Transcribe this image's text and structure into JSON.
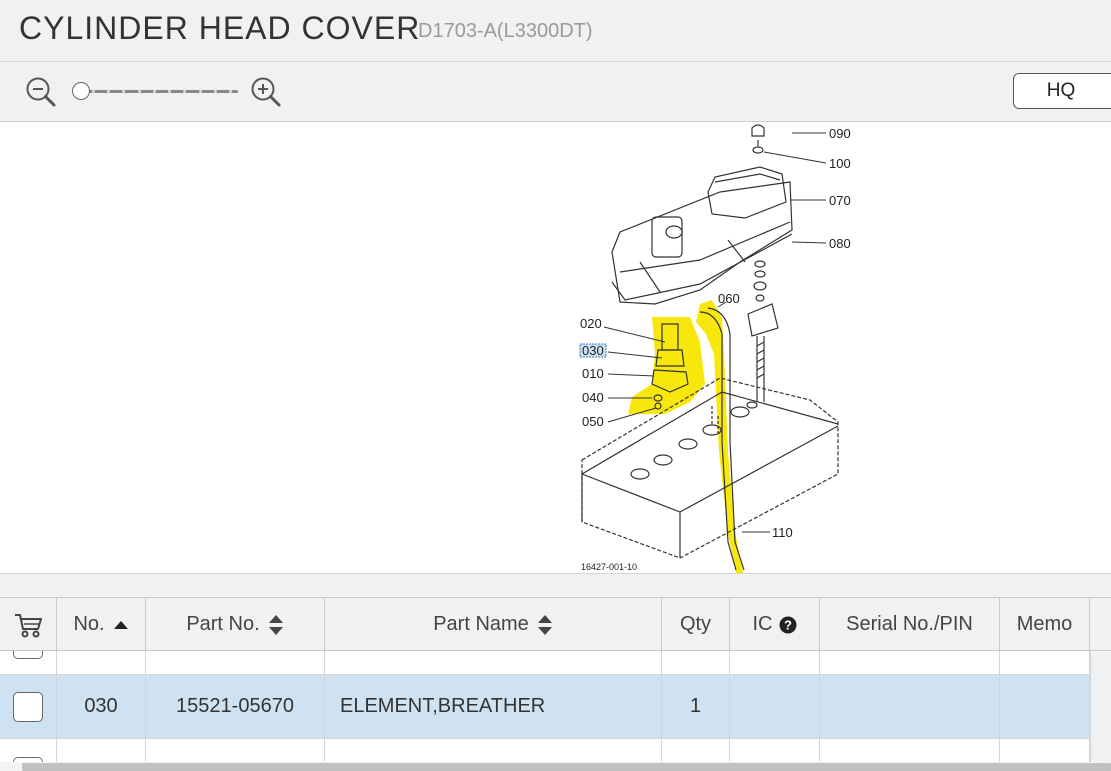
{
  "header": {
    "title": "CYLINDER HEAD COVER",
    "model": "D1703-A(L3300DT)"
  },
  "toolbar": {
    "zoom_out_icon": "zoom-out-icon",
    "zoom_in_icon": "zoom-in-icon",
    "zoom_level": 0,
    "hq_label": "HQ"
  },
  "diagram": {
    "callouts": {
      "c090": "090",
      "c100": "100",
      "c070": "070",
      "c080": "080",
      "c060": "060",
      "c020": "020",
      "c030": "030",
      "c010": "010",
      "c040": "040",
      "c050": "050",
      "c110": "110"
    },
    "drawing_code": "16427-001-10",
    "highlight_color": "#f7e600",
    "selected_callout": "030"
  },
  "table": {
    "columns": {
      "cart": "cart-icon",
      "no": "No.",
      "part_no": "Part No.",
      "part_name": "Part Name",
      "qty": "Qty",
      "ic": "IC",
      "serial": "Serial No./PIN",
      "memo": "Memo"
    },
    "sort_column": "No.",
    "sort_direction": "ascending",
    "selected_row": {
      "no": "030",
      "part_no": "15521-05670",
      "part_name": "ELEMENT,BREATHER",
      "qty": "1",
      "ic": "",
      "serial": "",
      "memo": ""
    },
    "selected_row_color": "#cfe2f2"
  }
}
